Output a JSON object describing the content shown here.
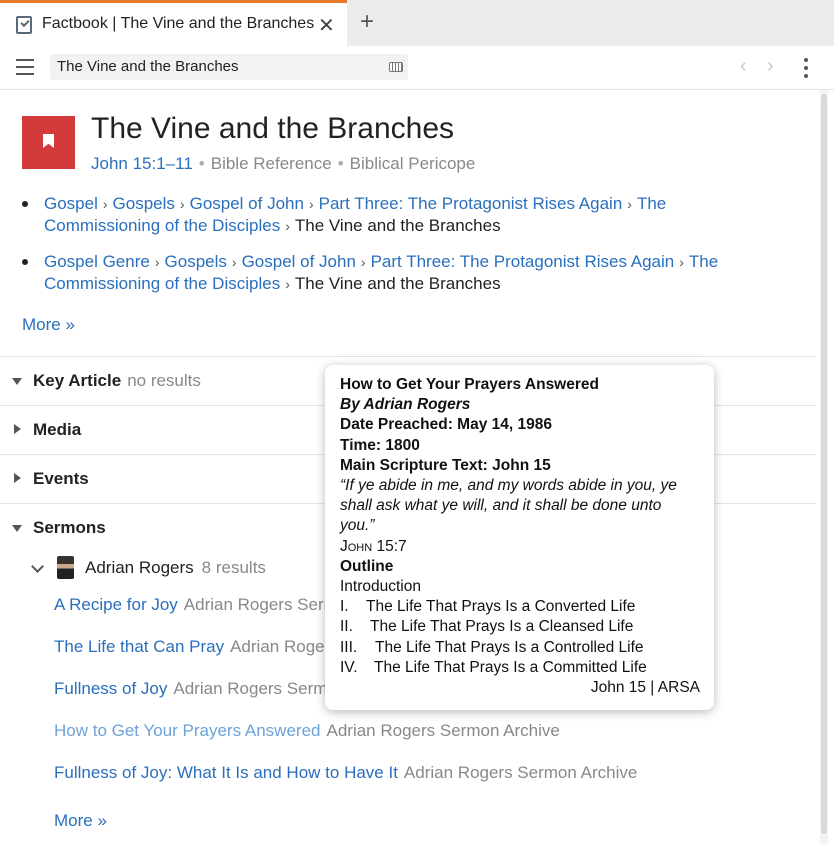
{
  "tab": {
    "title": "Factbook | The Vine and the Branches",
    "close": "✕",
    "add": "+"
  },
  "toolbar": {
    "address": "The Vine and the Branches",
    "back": "‹",
    "forward": "›"
  },
  "header": {
    "title": "The Vine and the Branches",
    "reference": "John 15:1–11",
    "type1": "Bible Reference",
    "type2": "Biblical Pericope",
    "dot": "•"
  },
  "breadcrumbs": [
    {
      "links": [
        "Gospel",
        "Gospels",
        "Gospel of John",
        "Part Three: The Protagonist Rises Again",
        "The Commissioning of the Disciples"
      ],
      "current": "The Vine and the Branches"
    },
    {
      "links": [
        "Gospel Genre",
        "Gospels",
        "Gospel of John",
        "Part Three: The Protagonist Rises Again",
        "The Commissioning of the Disciples"
      ],
      "current": "The Vine and the Branches"
    }
  ],
  "more_top": "More »",
  "sections": {
    "key_article": {
      "label": "Key Article",
      "note": "no results"
    },
    "media": {
      "label": "Media"
    },
    "events": {
      "label": "Events"
    },
    "sermons": {
      "label": "Sermons"
    }
  },
  "author": {
    "name": "Adrian Rogers",
    "count": "8 results"
  },
  "sermons": [
    {
      "title": "A Recipe for Joy",
      "source": "Adrian Rogers Sermon Archive"
    },
    {
      "title": "The Life that Can Pray",
      "source": "Adrian Rogers Sermon Archive"
    },
    {
      "title": "Fullness of Joy",
      "source": "Adrian Rogers Sermon Archive"
    },
    {
      "title": "How to Get Your Prayers Answered",
      "source": "Adrian Rogers Sermon Archive"
    },
    {
      "title": "Fullness of Joy: What It Is and How to Have It",
      "source": "Adrian Rogers Sermon Archive"
    }
  ],
  "more_bottom": "More »",
  "popup": {
    "title": "How to Get Your Prayers Answered",
    "byline": "By Adrian Rogers",
    "date": "Date Preached: May 14, 1986",
    "time": "Time: 1800",
    "scripture": "Main Scripture Text: John 15",
    "quote": "“If ye abide in me, and my words abide in you, ye shall ask what ye will, and it shall be done unto you.”",
    "quote_ref": "John 15:7",
    "outline_heading": "Outline",
    "intro": "Introduction",
    "outline": [
      {
        "num": "I.",
        "text": "The Life That Prays Is a Converted Life"
      },
      {
        "num": "II.",
        "text": "The Life That Prays Is a Cleansed Life"
      },
      {
        "num": "III.",
        "text": "The Life That Prays Is a Controlled Life"
      },
      {
        "num": "IV.",
        "text": "The Life That Prays Is a Committed Life"
      }
    ],
    "footer": "John 15 | ARSA"
  }
}
